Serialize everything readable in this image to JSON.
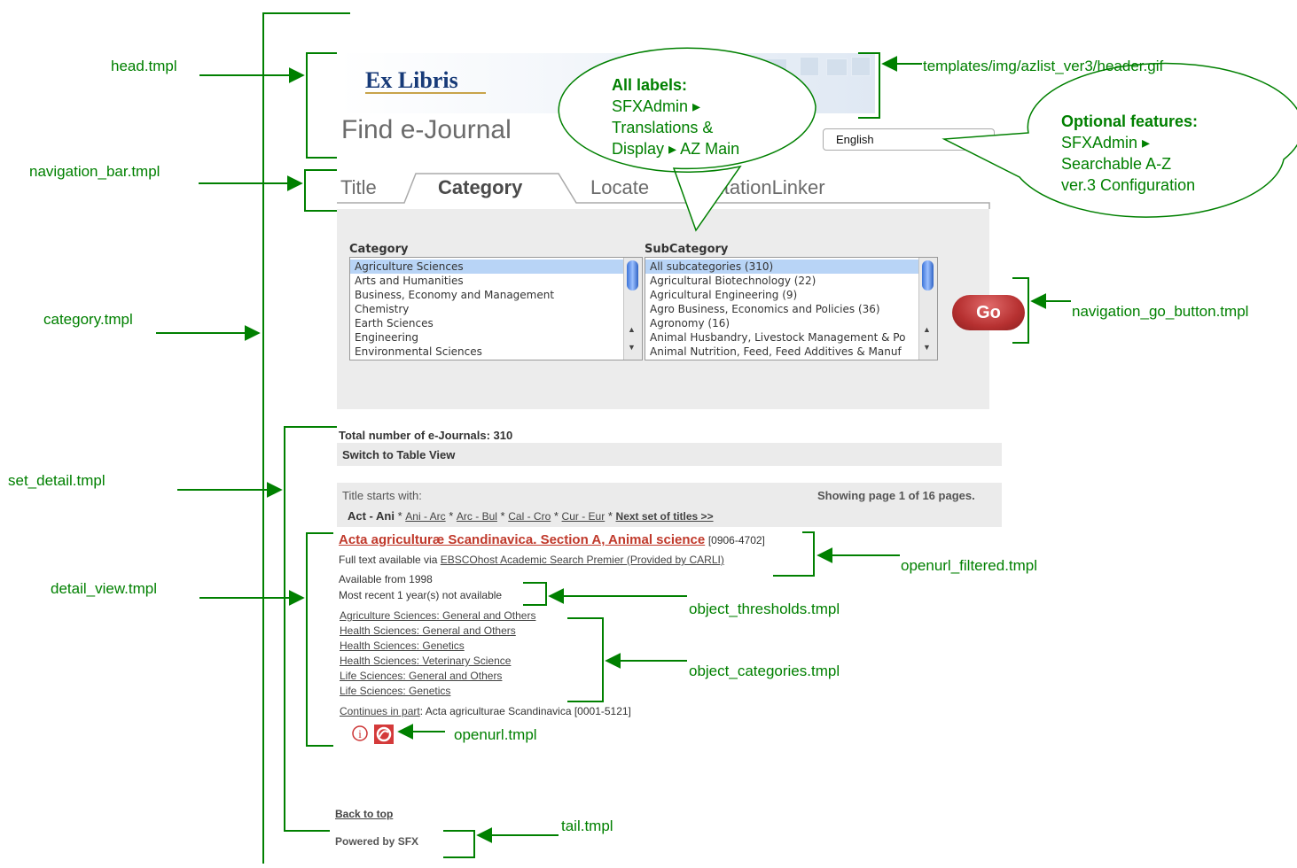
{
  "annotations": {
    "head": "head.tmpl",
    "navigation_bar": "navigation_bar.tmpl",
    "category": "category.tmpl",
    "set_detail": "set_detail.tmpl",
    "detail_view": "detail_view.tmpl",
    "header_gif": "templates/img/azlist_ver3/header.gif",
    "go_button": "navigation_go_button.tmpl",
    "openurl_filtered": "openurl_filtered.tmpl",
    "object_thresholds": "object_thresholds.tmpl",
    "object_categories": "object_categories.tmpl",
    "openurl": "openurl.tmpl",
    "tail": "tail.tmpl"
  },
  "callout_labels": {
    "heading": "All labels:",
    "line1": "SFXAdmin",
    "line2": "Translations &",
    "line3": "Display",
    "line3b": "AZ Main"
  },
  "callout_features": {
    "heading": "Optional features:",
    "line1": "SFXAdmin",
    "line2": "Searchable A-Z",
    "line3": "ver.3 Configuration"
  },
  "ui": {
    "logo": "Ex Libris",
    "page_title": "Find e-Journal",
    "language": "English",
    "tabs": [
      "Title",
      "Category",
      "Locate",
      "CitationLinker"
    ],
    "category_header": "Category",
    "subcategory_header": "SubCategory",
    "categories": [
      "Agriculture Sciences",
      "Arts and Humanities",
      "Business, Economy and Management",
      "Chemistry",
      "Earth Sciences",
      "Engineering",
      "Environmental Sciences"
    ],
    "subcategories": [
      "All subcategories (310)",
      "Agricultural Biotechnology (22)",
      "Agricultural Engineering (9)",
      "Agro Business, Economics and Policies (36)",
      "Agronomy (16)",
      "Animal Husbandry, Livestock Management & Po",
      "Animal Nutrition, Feed, Feed Additives & Manuf"
    ],
    "go_label": "Go",
    "total": "Total number of e-Journals: 310",
    "switch_view": "Switch to Table View",
    "title_starts": "Title starts with:",
    "showing": "Showing page 1 of 16 pages.",
    "range_current": "Act - Ani",
    "ranges": [
      "Ani - Arc",
      "Arc - Bul",
      "Cal - Cro",
      "Cur - Eur"
    ],
    "next_set": "Next set of titles >>",
    "journal_title": "Acta agriculturæ Scandinavica. Section A, Animal science",
    "issn": "[0906-4702]",
    "fulltext_prefix": "Full text available via",
    "fulltext_link": "EBSCOhost Academic Search Premier (Provided by CARLI)",
    "available_from": "Available from 1998",
    "most_recent": "Most recent 1 year(s) not available",
    "journal_categories": [
      "Agriculture Sciences: General and Others",
      "Health Sciences: General and Others",
      "Health Sciences: Genetics",
      "Health Sciences: Veterinary Science",
      "Life Sciences: General and Others",
      "Life Sciences: Genetics"
    ],
    "continues_link": "Continues in part",
    "continues_rest": ": Acta agriculturae Scandinavica [0001-5121]",
    "back_to_top": "Back to top",
    "powered_by": "Powered by SFX"
  }
}
